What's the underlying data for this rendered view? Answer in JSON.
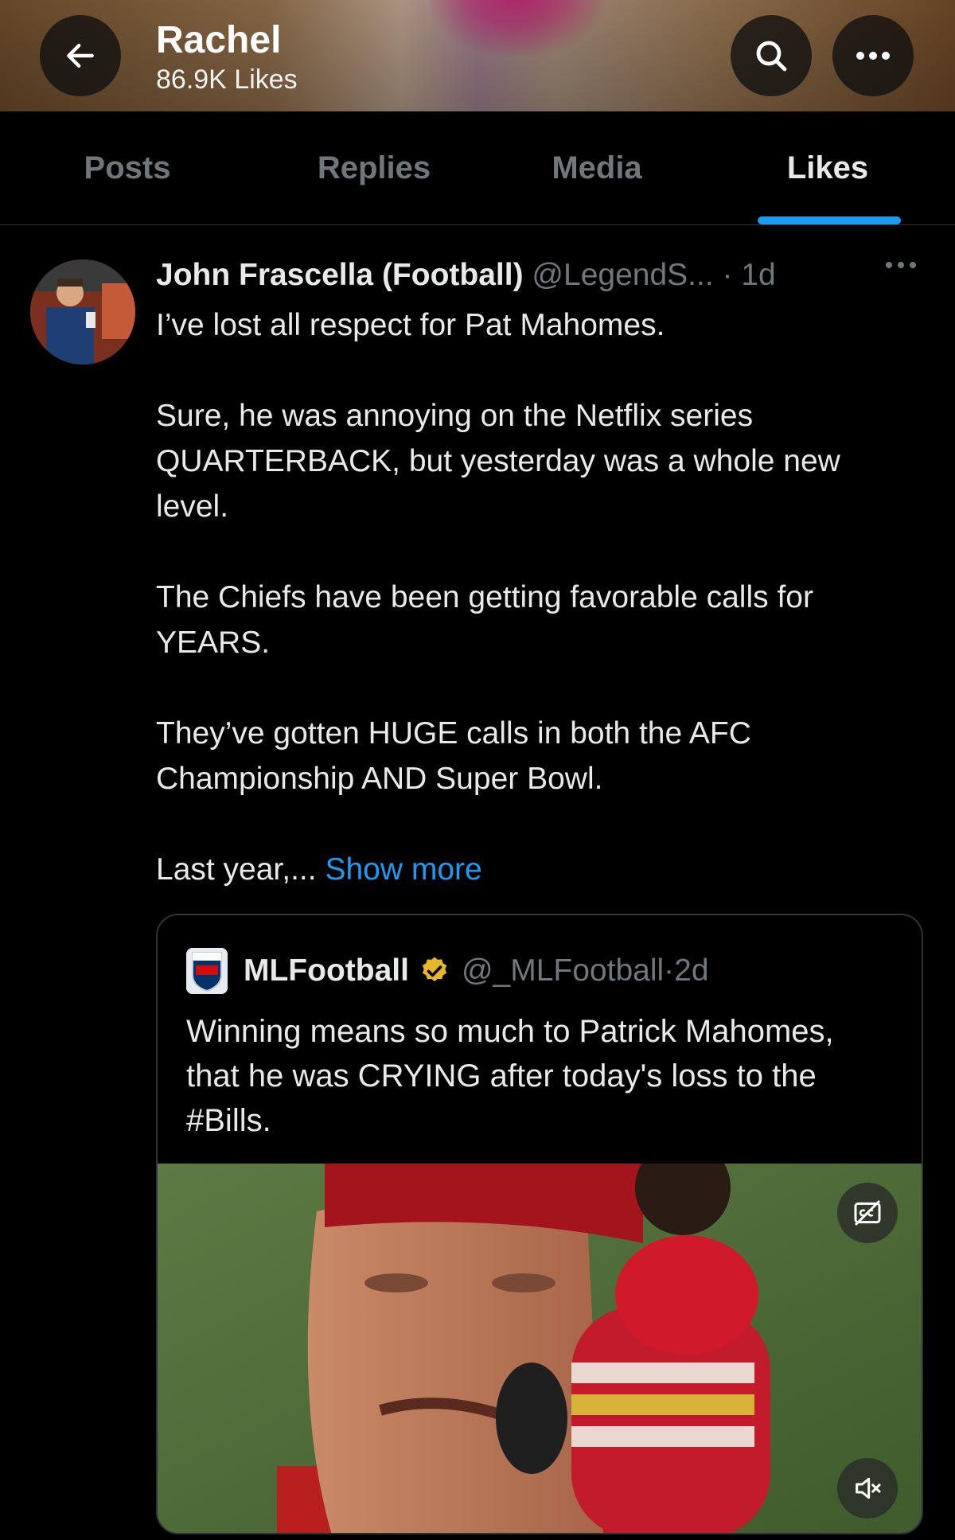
{
  "header": {
    "name": "Rachel",
    "likes_count": "86.9K Likes",
    "back_icon": "arrow-left-icon",
    "search_icon": "search-icon",
    "more_icon": "more-horizontal-icon"
  },
  "tabs": [
    {
      "label": "Posts",
      "active": false
    },
    {
      "label": "Replies",
      "active": false
    },
    {
      "label": "Media",
      "active": false
    },
    {
      "label": "Likes",
      "active": true
    }
  ],
  "post": {
    "author": "John Frascella (Football)",
    "handle": "@LegendS...",
    "separator": " · ",
    "time": "1d",
    "paragraphs": [
      "I’ve lost all respect for Pat Mahomes.",
      "Sure, he was annoying on the Netflix series QUARTERBACK, but yesterday was a whole new level.",
      "The Chiefs have been getting favorable calls for YEARS.",
      "They’ve gotten HUGE calls in both the AFC Championship AND Super Bowl."
    ],
    "truncated_text": "Last year,... ",
    "show_more": "Show more",
    "quote": {
      "author": "MLFootball",
      "verified": true,
      "handle": "@_MLFootball",
      "separator": " · ",
      "time": "2d",
      "text": "Winning means so much to Patrick Mahomes, that he was CRYING after today's loss to the #Bills.",
      "media_type": "video",
      "cc_icon": "captions-off-icon",
      "mute_icon": "volume-muted-icon"
    }
  },
  "colors": {
    "background": "#000000",
    "accent": "#1d9bf0",
    "text_primary": "#e7e9ea",
    "text_secondary": "#71767b",
    "verified_badge": "#e6b72a",
    "divider": "#2f3336"
  }
}
